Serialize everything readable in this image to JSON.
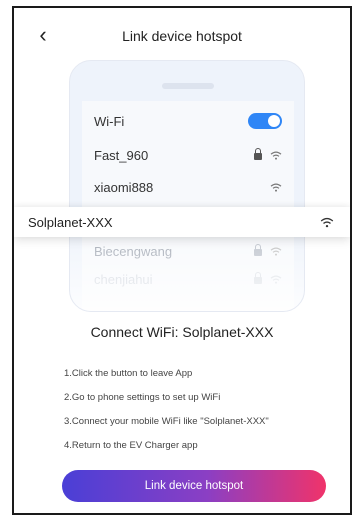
{
  "header": {
    "title": "Link device hotspot",
    "back_icon": "chevron-left-icon"
  },
  "phone": {
    "wifi_label": "Wi-Fi",
    "wifi_enabled": true,
    "networks": [
      {
        "ssid": "Fast_960",
        "locked": true
      },
      {
        "ssid": "xiaomi888",
        "locked": false
      },
      {
        "ssid": "Biecengwang",
        "locked": true
      },
      {
        "ssid": "chenjiahui",
        "locked": true
      }
    ],
    "highlighted_network": "Solplanet-XXX"
  },
  "connect_heading": "Connect WiFi: Solplanet-XXX",
  "steps": [
    "1.Click the button to leave App",
    "2.Go to phone settings to set up WiFi",
    "3.Connect your mobile WiFi like \"Solplanet-XXX\"",
    "4.Return to the EV Charger app"
  ],
  "cta": {
    "label": "Link device hotspot"
  },
  "colors": {
    "toggle": "#2f86f6",
    "gradient_start": "#4a3fd6",
    "gradient_end": "#f0336a"
  }
}
